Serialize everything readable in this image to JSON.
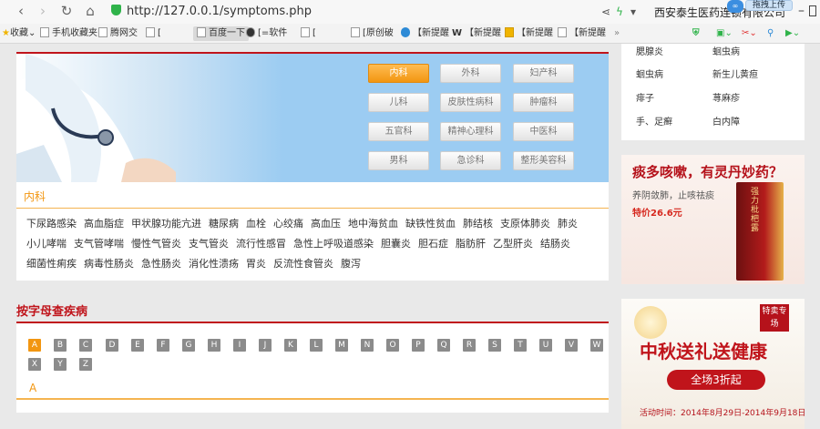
{
  "browser": {
    "address": "http://127.0.0.1/symptoms.php",
    "tab_title": "西安泰生医药连锁有限公司",
    "drag_upload": "拖拽上传"
  },
  "bookmarks": [
    {
      "label": "收藏"
    },
    {
      "label": "手机收藏夹"
    },
    {
      "label": "腾网交"
    },
    {
      "label": "["
    },
    {
      "label": "百度一下"
    },
    {
      "label": "[=软件"
    },
    {
      "label": "["
    },
    {
      "label": "[原创破"
    },
    {
      "label": "【新提醒"
    },
    {
      "label": "【新提醒"
    },
    {
      "label": "【新提醒"
    },
    {
      "label": "【新提醒"
    }
  ],
  "departments": [
    "内科",
    "外科",
    "妇产科",
    "儿科",
    "皮肤性病科",
    "肿瘤科",
    "五官科",
    "精神心理科",
    "中医科",
    "男科",
    "急诊科",
    "整形美容科"
  ],
  "active_department": "内科",
  "disease_rows": [
    [
      "下尿路感染",
      "高血脂症",
      "甲状腺功能亢进",
      "糖尿病",
      "血栓",
      "心绞痛",
      "高血压",
      "地中海贫血",
      "缺铁性贫血",
      "肺结核",
      "支原体肺炎",
      "肺炎"
    ],
    [
      "小儿哮喘",
      "支气管哮喘",
      "慢性气管炎",
      "支气管炎",
      "流行性感冒",
      "急性上呼吸道感染",
      "胆囊炎",
      "胆石症",
      "脂肪肝",
      "乙型肝炎",
      "结肠炎"
    ],
    [
      "细菌性痢疾",
      "病毒性肠炎",
      "急性肠炎",
      "消化性溃疡",
      "胃炎",
      "反流性食管炎",
      "腹泻"
    ]
  ],
  "letter_section": {
    "title": "按字母查疾病",
    "letters": [
      "A",
      "B",
      "C",
      "D",
      "E",
      "F",
      "G",
      "H",
      "I",
      "J",
      "K",
      "L",
      "M",
      "N",
      "O",
      "P",
      "Q",
      "R",
      "S",
      "T",
      "U",
      "V",
      "W",
      "X",
      "Y",
      "Z"
    ],
    "active": "A"
  },
  "side_list": [
    "腮腺炎",
    "蛔虫病",
    "蛔虫病",
    "新生儿黄疸",
    "痱子",
    "荨麻疹",
    "手、足癣",
    "白内障"
  ],
  "ad1": {
    "title": "痰多咳嗽，有灵丹妙药？",
    "subtitle": "养阴敛肺，止咳祛痰",
    "price": "特价26.6元",
    "box_label": "强力枇杷露"
  },
  "ad2": {
    "stamp": "特卖专场",
    "title": "中秋送礼送健康",
    "pill": "全场3折起",
    "date": "活动时间：2014年8月29日-2014年9月18日"
  }
}
